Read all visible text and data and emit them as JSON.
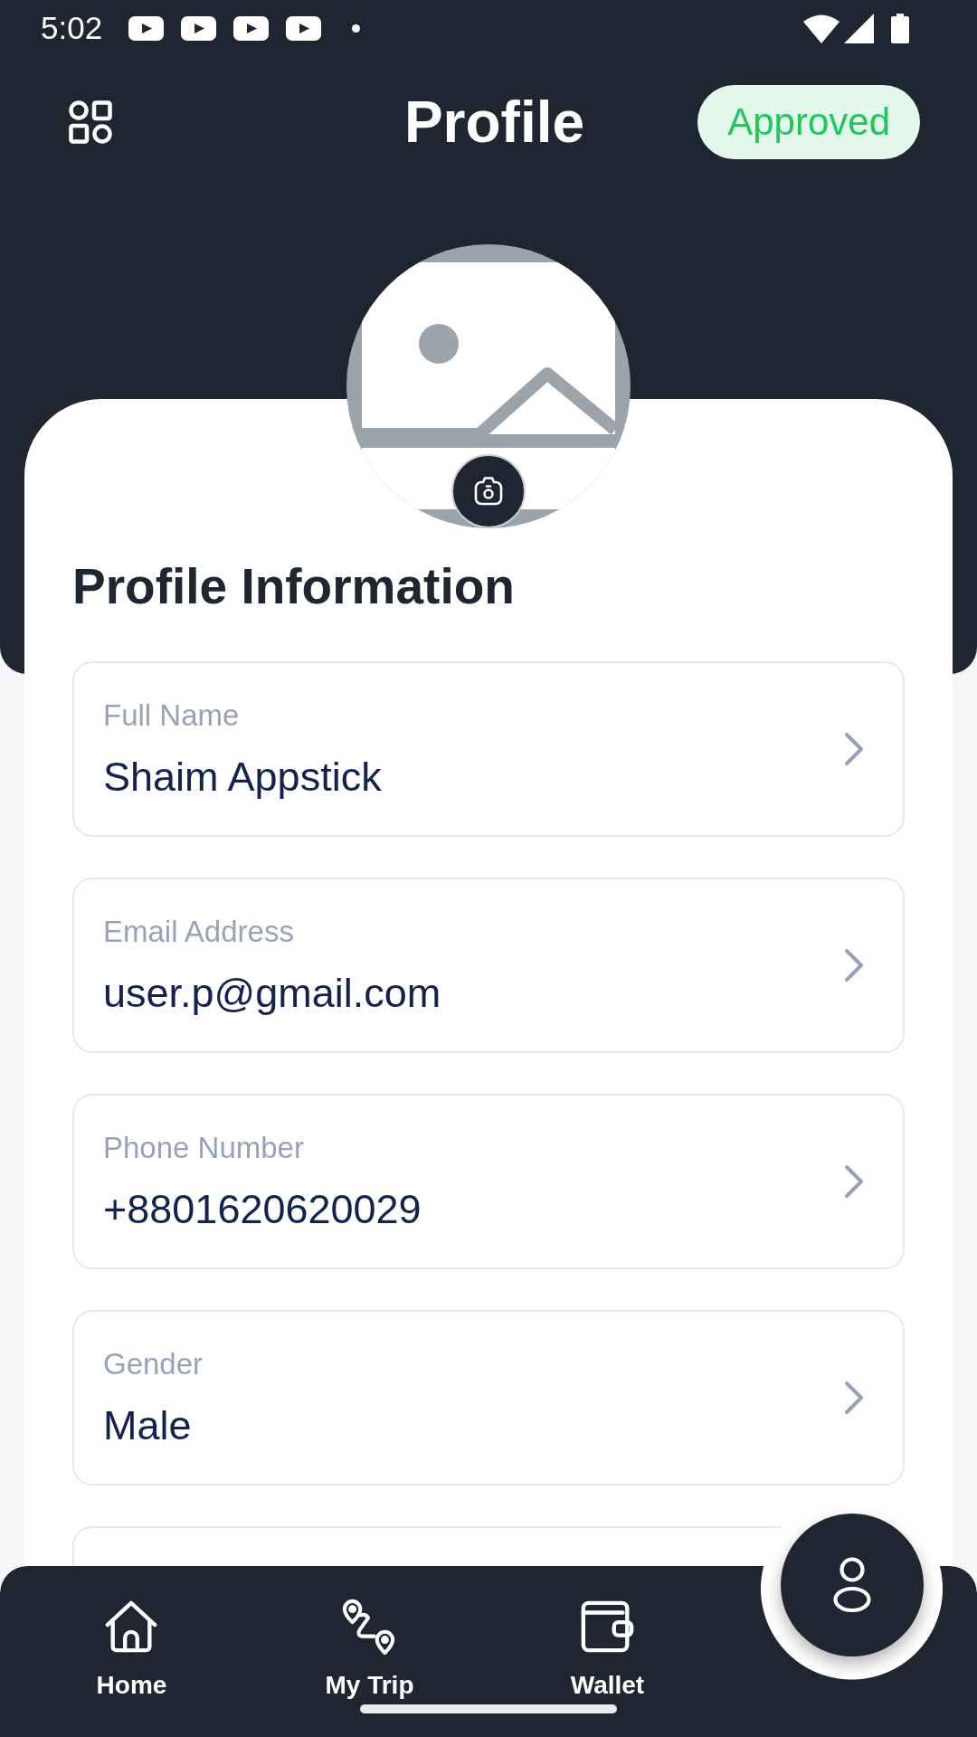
{
  "status_bar": {
    "time": "5:02"
  },
  "header": {
    "title": "Profile",
    "status_badge": "Approved"
  },
  "profile": {
    "section_title": "Profile Information",
    "fields": [
      {
        "label": "Full Name",
        "value": "Shaim Appstick"
      },
      {
        "label": "Email Address",
        "value": "user.p@gmail.com"
      },
      {
        "label": "Phone Number",
        "value": "+8801620620029"
      },
      {
        "label": "Gender",
        "value": "Male"
      }
    ]
  },
  "bottom_nav": {
    "items": [
      {
        "label": "Home",
        "selected": false
      },
      {
        "label": "My Trip",
        "selected": false
      },
      {
        "label": "Wallet",
        "selected": false
      },
      {
        "selected": true
      }
    ]
  }
}
